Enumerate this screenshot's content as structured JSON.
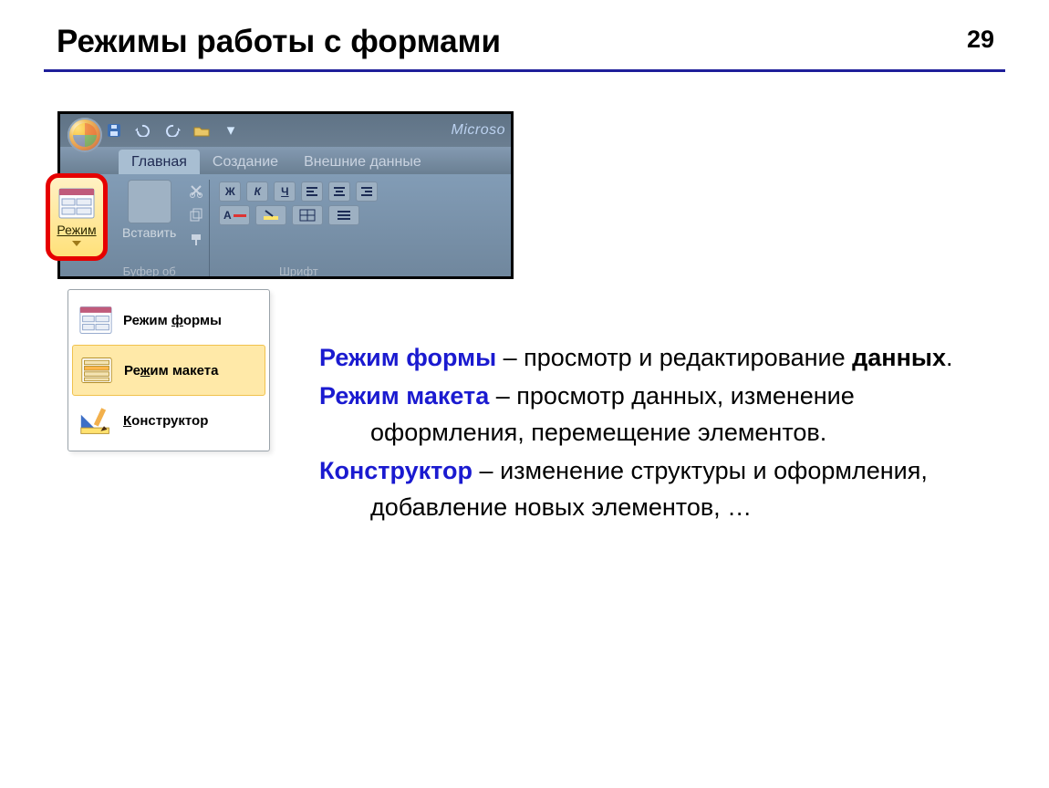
{
  "header": {
    "title": "Режимы работы с формами",
    "page_number": "29"
  },
  "ribbon": {
    "app_hint": "Microso",
    "tabs": [
      "Главная",
      "Создание",
      "Внешние данные"
    ],
    "mode_button": "Режим",
    "paste_button": "Вставить",
    "clipboard_group": "Буфер об",
    "font_group": "Шрифт",
    "fmt": {
      "b": "Ж",
      "i": "К",
      "u": "Ч",
      "a": "А"
    }
  },
  "menu": {
    "items": [
      {
        "pre": "Режим ",
        "u": "ф",
        "post": "ормы"
      },
      {
        "pre": "Ре",
        "u": "ж",
        "post": "им макета"
      },
      {
        "pre": "",
        "u": "К",
        "post": "онструктор"
      }
    ]
  },
  "desc": {
    "l1_term": "Режим формы",
    "l1_rest_a": " – просмотр и редактирование ",
    "l1_bold": "данных",
    "l1_rest_b": ".",
    "l2_term": "Режим макета",
    "l2_rest": " – просмотр данных, изменение оформления, перемещение элементов.",
    "l3_term": "Конструктор",
    "l3_rest": " – изменение структуры и оформления, добавление новых элементов, …"
  }
}
